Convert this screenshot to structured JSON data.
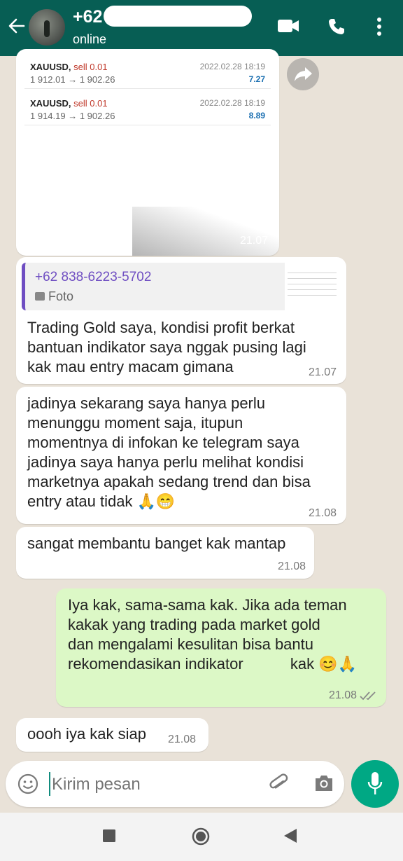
{
  "header": {
    "back_icon": "arrow-left-icon",
    "contact_name": "+62",
    "status": "online",
    "icons": [
      "video-call-icon",
      "phone-icon",
      "more-vert-icon"
    ]
  },
  "messages": {
    "image_message": {
      "trades": [
        {
          "symbol": "XAUUSD,",
          "side": "sell 0.01",
          "prices": "1 912.01 → 1 902.26",
          "date": "2022.02.28 18:19",
          "profit": "7.27"
        },
        {
          "symbol": "XAUUSD,",
          "side": "sell 0.01",
          "prices": "1 914.19 → 1 902.26",
          "date": "2022.02.28 18:19",
          "profit": "8.89"
        }
      ],
      "time": "21.07"
    },
    "quoted_reply": {
      "quoted_name": "+62 838-6223-5702",
      "quoted_type": "Foto",
      "lines": [
        "Trading Gold saya, kondisi profit berkat",
        "bantuan indikator saya nggak pusing lagi",
        "kak mau entry macam gimana"
      ],
      "time": "21.07"
    },
    "msg3": {
      "lines": [
        "jadinya sekarang saya hanya perlu",
        "menunggu moment saja, itupun",
        "momentnya di infokan ke telegram saya",
        "jadinya saya hanya perlu melihat kondisi",
        "marketnya apakah sedang trend dan bisa",
        "entry atau tidak 🙏😁"
      ],
      "time": "21.08"
    },
    "msg4": {
      "text": "sangat membantu banget kak mantap",
      "time": "21.08"
    },
    "msg5_out": {
      "lines": [
        "Iya kak, sama-sama kak. Jika ada teman",
        "kakak yang trading pada market gold",
        "dan mengalami kesulitan bisa bantu",
        "rekomendasikan indikator           kak 😊🙏"
      ],
      "time": "21.08",
      "status_icon": "double-check-icon"
    },
    "msg6": {
      "text": "oooh iya kak siap",
      "time": "21.08"
    }
  },
  "input": {
    "placeholder": "Kirim pesan",
    "icons": [
      "emoji-icon",
      "attach-icon",
      "camera-icon",
      "mic-icon"
    ]
  },
  "navbar": {
    "icons": [
      "recents-icon",
      "home-icon",
      "back-icon"
    ]
  },
  "colors": {
    "header": "#075e54",
    "outgoing_bubble": "#dcf8c6",
    "incoming_bubble": "#ffffff",
    "accent": "#00a884",
    "quote_bar": "#6f4ec2"
  }
}
